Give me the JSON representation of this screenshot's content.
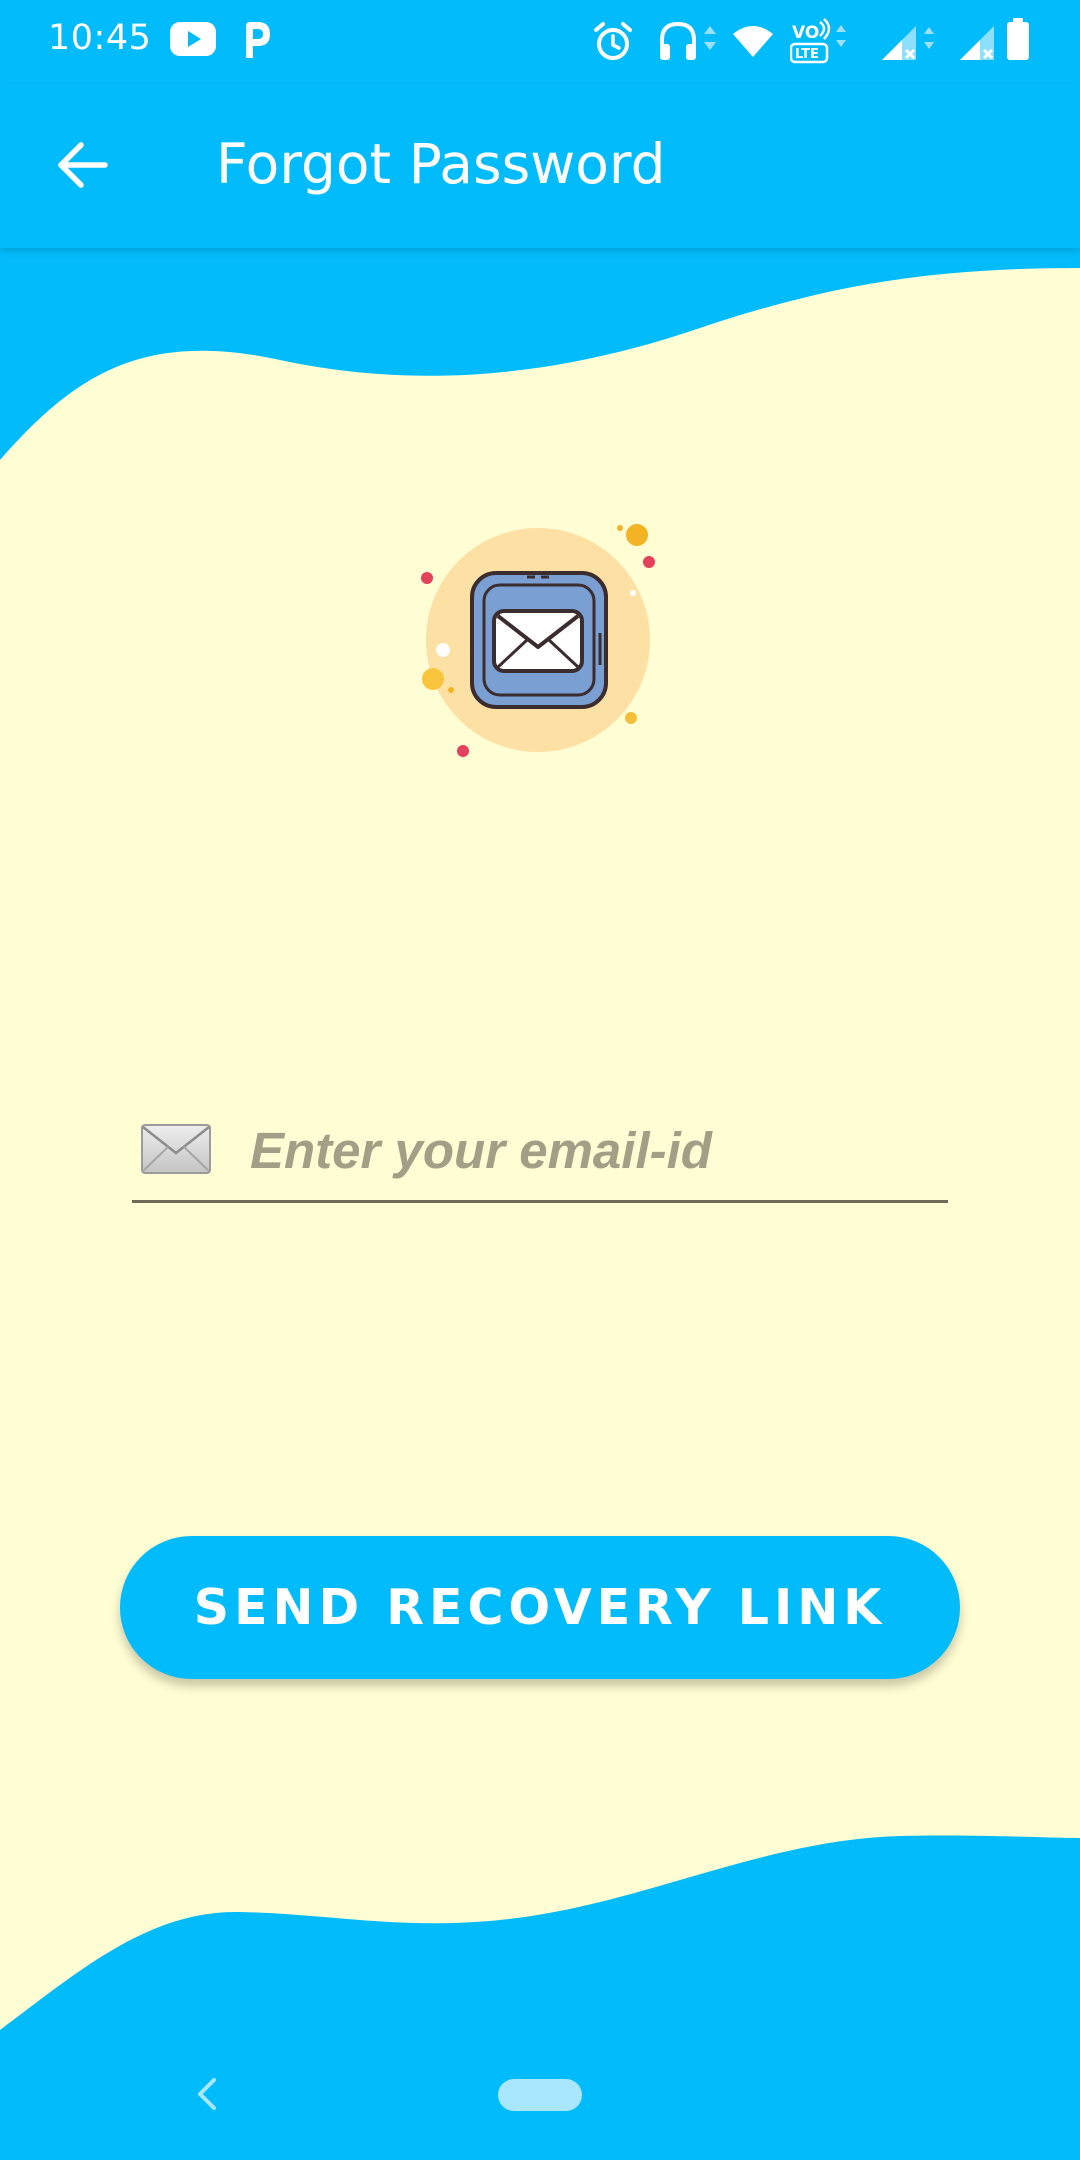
{
  "status_bar": {
    "time": "10:45",
    "left_icons": [
      "youtube-icon",
      "parking-icon"
    ],
    "right_icons": [
      "alarm-icon",
      "headphones-icon",
      "wifi-icon",
      "volte-icon",
      "signal-icon",
      "signal-icon",
      "battery-icon"
    ]
  },
  "app_bar": {
    "title": "Forgot Password",
    "back_icon": "arrow-left-icon"
  },
  "illustration": {
    "icon": "mail-envelope-icon"
  },
  "form": {
    "email_placeholder": "Enter your email-id",
    "email_value": "",
    "email_icon": "envelope-icon"
  },
  "actions": {
    "send_label": "SEND RECOVERY LINK"
  },
  "navigation": {
    "back_icon": "nav-back-icon",
    "home_icon": "home-pill-icon"
  },
  "colors": {
    "primary": "#02BBFB",
    "background": "#FFFDD3",
    "underline": "#6E6A55",
    "placeholder": "#A29F86"
  }
}
